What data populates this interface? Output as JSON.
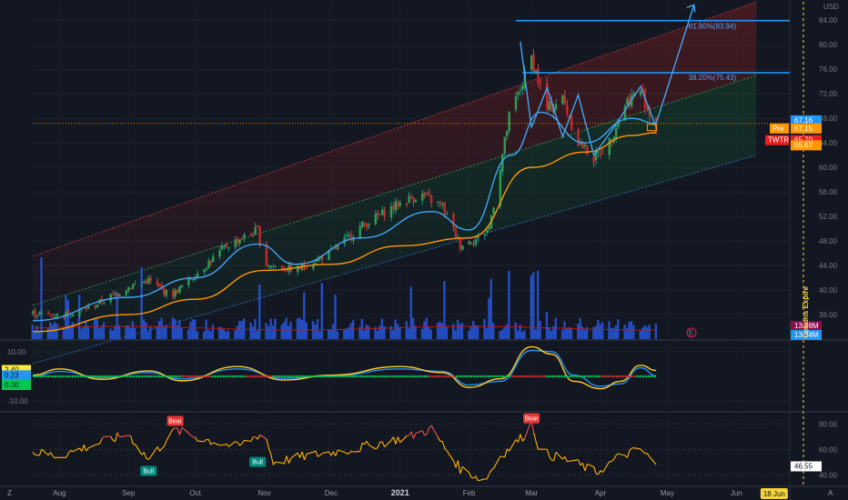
{
  "currency": "USD",
  "price_axis_ticks": [
    "84.00",
    "80.00",
    "76.00",
    "72.00",
    "68.00",
    "64.00",
    "60.00",
    "56.00",
    "52.00",
    "48.00",
    "44.00",
    "40.00",
    "36.00"
  ],
  "price_tags": [
    {
      "text": "67.16",
      "color": "#2196f3"
    },
    {
      "text": "67.15",
      "color": "#ff9800",
      "prefix": "Pre"
    },
    {
      "text": "65.70",
      "color": "#e91e1e",
      "prefix": "TWTR"
    },
    {
      "text": "65.67",
      "color": "#ff9800"
    },
    {
      "text": "13.98M",
      "color": "#880e4f"
    },
    {
      "text": "13.34M",
      "color": "#2196f3"
    }
  ],
  "fib_labels": [
    "61.80%(83.94)",
    "38.20%(75.43)"
  ],
  "options_label": "Options Expire",
  "osc_axis_ticks": [
    "10.00",
    "-10.00"
  ],
  "osc_tags": [
    {
      "text": "2.40",
      "color": "#ffeb3b"
    },
    {
      "text": "0.23",
      "color": "#2196f3"
    },
    {
      "text": "0.00",
      "color": "#00c853"
    }
  ],
  "rsi_axis_ticks": [
    "80.00",
    "60.00",
    "40.00"
  ],
  "rsi_tag": {
    "text": "46.55",
    "color": "#ffffff"
  },
  "signal_labels": [
    {
      "text": "Bull",
      "kind": "bull"
    },
    {
      "text": "Bear",
      "kind": "bear"
    },
    {
      "text": "Bull",
      "kind": "bull"
    },
    {
      "text": "Bear",
      "kind": "bear"
    }
  ],
  "x_ticks": [
    "Aug",
    "Sep",
    "Oct",
    "Nov",
    "Dec",
    "2021",
    "Feb",
    "Mar",
    "Apr",
    "May",
    "Jun"
  ],
  "x_tag": "18 Jun",
  "markers": [
    "Z",
    "A",
    "E"
  ],
  "chart_data": {
    "type": "line",
    "ticker": "TWTR",
    "x_range": [
      "2020-07-20",
      "2021-06-25"
    ],
    "price_ylim": [
      32,
      87
    ],
    "price_close": [
      [
        "2020-07-20",
        36.2
      ],
      [
        "2020-08-01",
        35.8
      ],
      [
        "2020-08-15",
        37.2
      ],
      [
        "2020-09-01",
        40.5
      ],
      [
        "2020-09-10",
        41.6
      ],
      [
        "2020-09-20",
        39.0
      ],
      [
        "2020-10-01",
        42.5
      ],
      [
        "2020-10-15",
        47.2
      ],
      [
        "2020-10-29",
        49.8
      ],
      [
        "2020-11-01",
        44.2
      ],
      [
        "2020-11-15",
        43.2
      ],
      [
        "2020-12-01",
        46.2
      ],
      [
        "2020-12-15",
        50.5
      ],
      [
        "2021-01-01",
        54.2
      ],
      [
        "2021-01-10",
        55.6
      ],
      [
        "2021-01-20",
        53.6
      ],
      [
        "2021-01-28",
        47.4
      ],
      [
        "2021-02-05",
        48.4
      ],
      [
        "2021-02-10",
        50.2
      ],
      [
        "2021-02-15",
        60.1
      ],
      [
        "2021-02-19",
        68.2
      ],
      [
        "2021-02-25",
        73.8
      ],
      [
        "2021-03-01",
        77.9
      ],
      [
        "2021-03-08",
        69.5
      ],
      [
        "2021-03-15",
        71.2
      ],
      [
        "2021-03-22",
        64.2
      ],
      [
        "2021-03-29",
        61.5
      ],
      [
        "2021-04-05",
        64.1
      ],
      [
        "2021-04-12",
        70.5
      ],
      [
        "2021-04-19",
        72.6
      ],
      [
        "2021-04-26",
        66.1
      ]
    ],
    "ema_fast": [
      [
        "2020-07-20",
        35.0
      ],
      [
        "2020-09-01",
        38.8
      ],
      [
        "2020-10-01",
        42.0
      ],
      [
        "2020-10-29",
        47.5
      ],
      [
        "2020-11-15",
        44.2
      ],
      [
        "2020-12-15",
        48.5
      ],
      [
        "2021-01-15",
        52.8
      ],
      [
        "2021-02-01",
        49.8
      ],
      [
        "2021-02-20",
        62.0
      ],
      [
        "2021-03-05",
        69.0
      ],
      [
        "2021-03-25",
        64.0
      ],
      [
        "2021-04-15",
        68.0
      ],
      [
        "2021-04-26",
        67.16
      ]
    ],
    "ema_slow": [
      [
        "2020-07-20",
        33.2
      ],
      [
        "2020-09-01",
        36.0
      ],
      [
        "2020-10-01",
        38.5
      ],
      [
        "2020-11-01",
        43.2
      ],
      [
        "2020-12-01",
        44.2
      ],
      [
        "2021-01-01",
        47.2
      ],
      [
        "2021-02-01",
        48.5
      ],
      [
        "2021-03-01",
        60.0
      ],
      [
        "2021-03-25",
        62.5
      ],
      [
        "2021-04-15",
        65.2
      ],
      [
        "2021-04-26",
        65.67
      ]
    ],
    "volume_last_millions": 13.34,
    "volume_avg_millions": 13.98,
    "fib_levels": [
      {
        "pct": "61.80%",
        "price": 83.94
      },
      {
        "pct": "38.20%",
        "price": 75.43
      }
    ],
    "projection_target_price": 86.5,
    "oscillator": {
      "ylim": [
        -14,
        14
      ],
      "fast_last": 2.4,
      "slow_last": 0.23,
      "zero": 0.0,
      "fast": [
        [
          "2020-07-20",
          0.5
        ],
        [
          "2020-08-01",
          3.0
        ],
        [
          "2020-08-20",
          -1.2
        ],
        [
          "2020-09-10",
          2.2
        ],
        [
          "2020-09-25",
          -1.8
        ],
        [
          "2020-10-20",
          4.0
        ],
        [
          "2020-11-10",
          -1.5
        ],
        [
          "2020-12-01",
          0.5
        ],
        [
          "2021-01-01",
          4.0
        ],
        [
          "2021-01-20",
          1.5
        ],
        [
          "2021-02-01",
          -4.5
        ],
        [
          "2021-02-15",
          -1.0
        ],
        [
          "2021-03-01",
          12.0
        ],
        [
          "2021-03-10",
          9.0
        ],
        [
          "2021-03-20",
          -2.0
        ],
        [
          "2021-04-01",
          -5.0
        ],
        [
          "2021-04-10",
          -2.0
        ],
        [
          "2021-04-19",
          4.5
        ],
        [
          "2021-04-26",
          2.4
        ]
      ],
      "slow": [
        [
          "2020-07-20",
          0.0
        ],
        [
          "2020-08-01",
          2.0
        ],
        [
          "2020-08-20",
          -0.5
        ],
        [
          "2020-09-10",
          1.5
        ],
        [
          "2020-09-25",
          -1.0
        ],
        [
          "2020-10-20",
          3.0
        ],
        [
          "2020-11-10",
          -0.8
        ],
        [
          "2020-12-01",
          0.2
        ],
        [
          "2021-01-01",
          3.0
        ],
        [
          "2021-01-20",
          2.0
        ],
        [
          "2021-02-01",
          -3.5
        ],
        [
          "2021-02-15",
          -2.0
        ],
        [
          "2021-03-01",
          10.5
        ],
        [
          "2021-03-10",
          10.0
        ],
        [
          "2021-03-20",
          0.5
        ],
        [
          "2021-04-01",
          -4.0
        ],
        [
          "2021-04-10",
          -3.0
        ],
        [
          "2021-04-19",
          3.5
        ],
        [
          "2021-04-26",
          0.23
        ]
      ]
    },
    "rsi": {
      "ylim": [
        32,
        88
      ],
      "last": 46.55,
      "values": [
        [
          "2020-07-20",
          58
        ],
        [
          "2020-08-01",
          55
        ],
        [
          "2020-08-15",
          63
        ],
        [
          "2020-09-01",
          72
        ],
        [
          "2020-09-10",
          52
        ],
        [
          "2020-09-22",
          75
        ],
        [
          "2020-10-05",
          68
        ],
        [
          "2020-10-20",
          62
        ],
        [
          "2020-11-01",
          74
        ],
        [
          "2020-11-05",
          50
        ],
        [
          "2020-11-20",
          55
        ],
        [
          "2020-12-10",
          60
        ],
        [
          "2021-01-05",
          70
        ],
        [
          "2021-01-15",
          76
        ],
        [
          "2021-01-28",
          45
        ],
        [
          "2021-02-08",
          36
        ],
        [
          "2021-02-15",
          55
        ],
        [
          "2021-02-25",
          70
        ],
        [
          "2021-03-01",
          81
        ],
        [
          "2021-03-05",
          58
        ],
        [
          "2021-03-20",
          50
        ],
        [
          "2021-03-30",
          42
        ],
        [
          "2021-04-10",
          55
        ],
        [
          "2021-04-19",
          60
        ],
        [
          "2021-04-26",
          48
        ]
      ]
    }
  }
}
